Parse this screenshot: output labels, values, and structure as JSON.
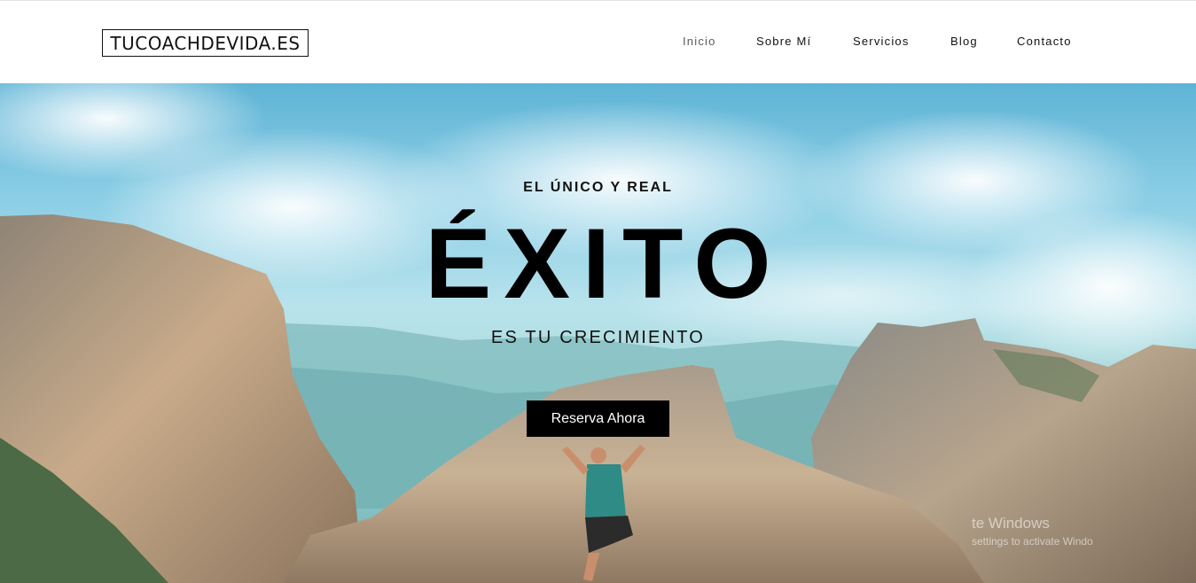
{
  "header": {
    "logo_text": "TUCOACHDEVIDA.ES",
    "nav": [
      {
        "label": "Inicio",
        "active": true
      },
      {
        "label": "Sobre Mí",
        "active": false
      },
      {
        "label": "Servicios",
        "active": false
      },
      {
        "label": "Blog",
        "active": false
      },
      {
        "label": "Contacto",
        "active": false
      }
    ]
  },
  "hero": {
    "eyebrow": "EL ÚNICO Y REAL",
    "headline": "ÉXITO",
    "subhead": "ES TU CRECIMIENTO",
    "cta_label": "Reserva Ahora",
    "background_image": "mountain-climber-cliffs-photo"
  },
  "system_watermark": {
    "line1": "te Windows",
    "line2": "settings to activate Windo"
  },
  "colors": {
    "accent": "#000000",
    "text": "#111111",
    "sky": "#8fd0e6",
    "rock": "#b09a82"
  }
}
